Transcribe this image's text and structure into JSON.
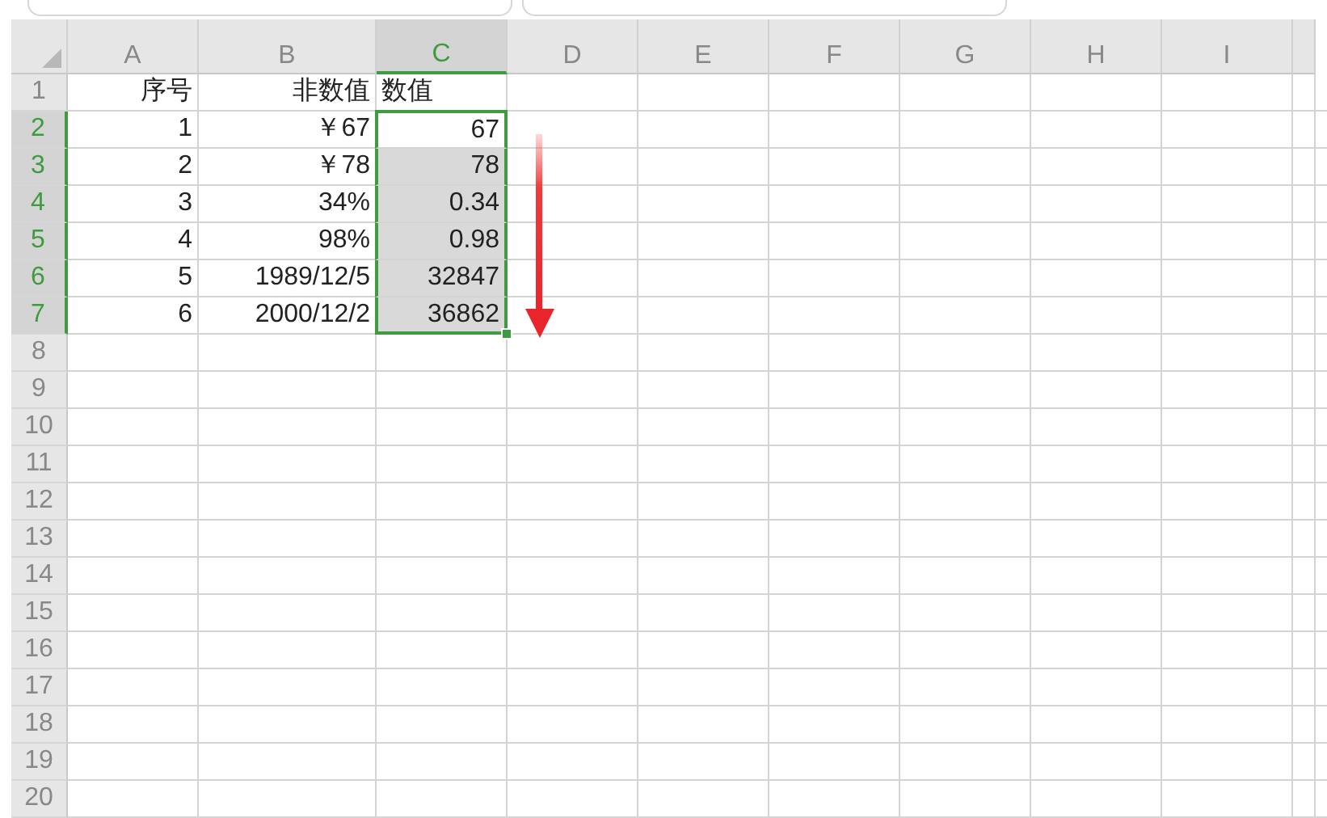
{
  "columns": [
    {
      "label": "A",
      "selected": false
    },
    {
      "label": "B",
      "selected": false
    },
    {
      "label": "C",
      "selected": true
    },
    {
      "label": "D",
      "selected": false
    },
    {
      "label": "E",
      "selected": false
    },
    {
      "label": "F",
      "selected": false
    },
    {
      "label": "G",
      "selected": false
    },
    {
      "label": "H",
      "selected": false
    },
    {
      "label": "I",
      "selected": false
    }
  ],
  "rows": [
    {
      "number": "1",
      "selected": false,
      "cells": [
        {
          "text": "序号",
          "kind": "right",
          "selected": false
        },
        {
          "text": "非数值",
          "kind": "right",
          "selected": false
        },
        {
          "text": "数值",
          "kind": "left",
          "selected": false
        }
      ]
    },
    {
      "number": "2",
      "selected": true,
      "cells": [
        {
          "text": "1",
          "kind": "right",
          "selected": false
        },
        {
          "text": "￥67",
          "kind": "right",
          "selected": false
        },
        {
          "text": "67",
          "kind": "right",
          "selected": true,
          "active": true
        }
      ]
    },
    {
      "number": "3",
      "selected": true,
      "cells": [
        {
          "text": "2",
          "kind": "right",
          "selected": false
        },
        {
          "text": "￥78",
          "kind": "right",
          "selected": false
        },
        {
          "text": "78",
          "kind": "right",
          "selected": true,
          "active": false
        }
      ]
    },
    {
      "number": "4",
      "selected": true,
      "cells": [
        {
          "text": "3",
          "kind": "right",
          "selected": false
        },
        {
          "text": "34%",
          "kind": "right",
          "selected": false
        },
        {
          "text": "0.34",
          "kind": "right",
          "selected": true,
          "active": false
        }
      ]
    },
    {
      "number": "5",
      "selected": true,
      "cells": [
        {
          "text": "4",
          "kind": "right",
          "selected": false
        },
        {
          "text": "98%",
          "kind": "right",
          "selected": false
        },
        {
          "text": "0.98",
          "kind": "right",
          "selected": true,
          "active": false
        }
      ]
    },
    {
      "number": "6",
      "selected": true,
      "cells": [
        {
          "text": "5",
          "kind": "right",
          "selected": false
        },
        {
          "text": "1989/12/5",
          "kind": "right",
          "selected": false
        },
        {
          "text": "32847",
          "kind": "right",
          "selected": true,
          "active": false
        }
      ]
    },
    {
      "number": "7",
      "selected": true,
      "cells": [
        {
          "text": "6",
          "kind": "right",
          "selected": false
        },
        {
          "text": "2000/12/2",
          "kind": "right",
          "selected": false
        },
        {
          "text": "36862",
          "kind": "right",
          "selected": true,
          "active": false
        }
      ]
    },
    {
      "number": "8",
      "selected": false
    },
    {
      "number": "9",
      "selected": false
    },
    {
      "number": "10",
      "selected": false
    },
    {
      "number": "11",
      "selected": false
    },
    {
      "number": "12",
      "selected": false
    },
    {
      "number": "13",
      "selected": false
    },
    {
      "number": "14",
      "selected": false
    },
    {
      "number": "15",
      "selected": false
    },
    {
      "number": "16",
      "selected": false
    },
    {
      "number": "17",
      "selected": false
    },
    {
      "number": "18",
      "selected": false
    },
    {
      "number": "19",
      "selected": false
    },
    {
      "number": "20",
      "selected": false
    }
  ]
}
